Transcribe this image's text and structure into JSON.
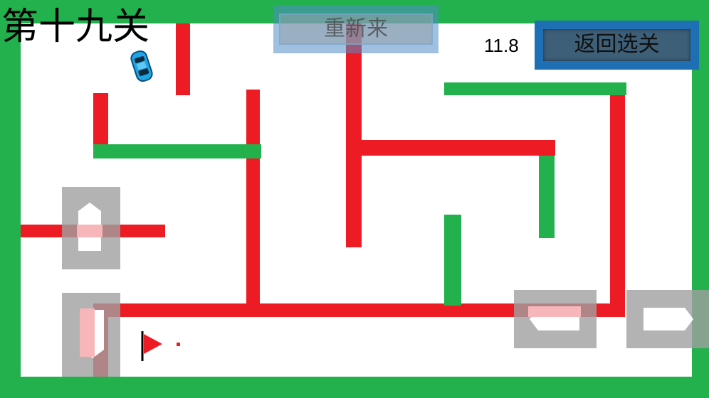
{
  "level": {
    "title": "第十九关"
  },
  "timer": {
    "value": "11.8"
  },
  "buttons": {
    "restart_label": "重新来",
    "back_label": "返回选关"
  },
  "colors": {
    "border": "#22b14c",
    "wall_red": "#ed1c24",
    "wall_green": "#22b14c",
    "field": "#ffffff",
    "back_button": "#1f6fb5"
  },
  "icons": {
    "player": "car-icon",
    "goal": "flag-icon"
  }
}
